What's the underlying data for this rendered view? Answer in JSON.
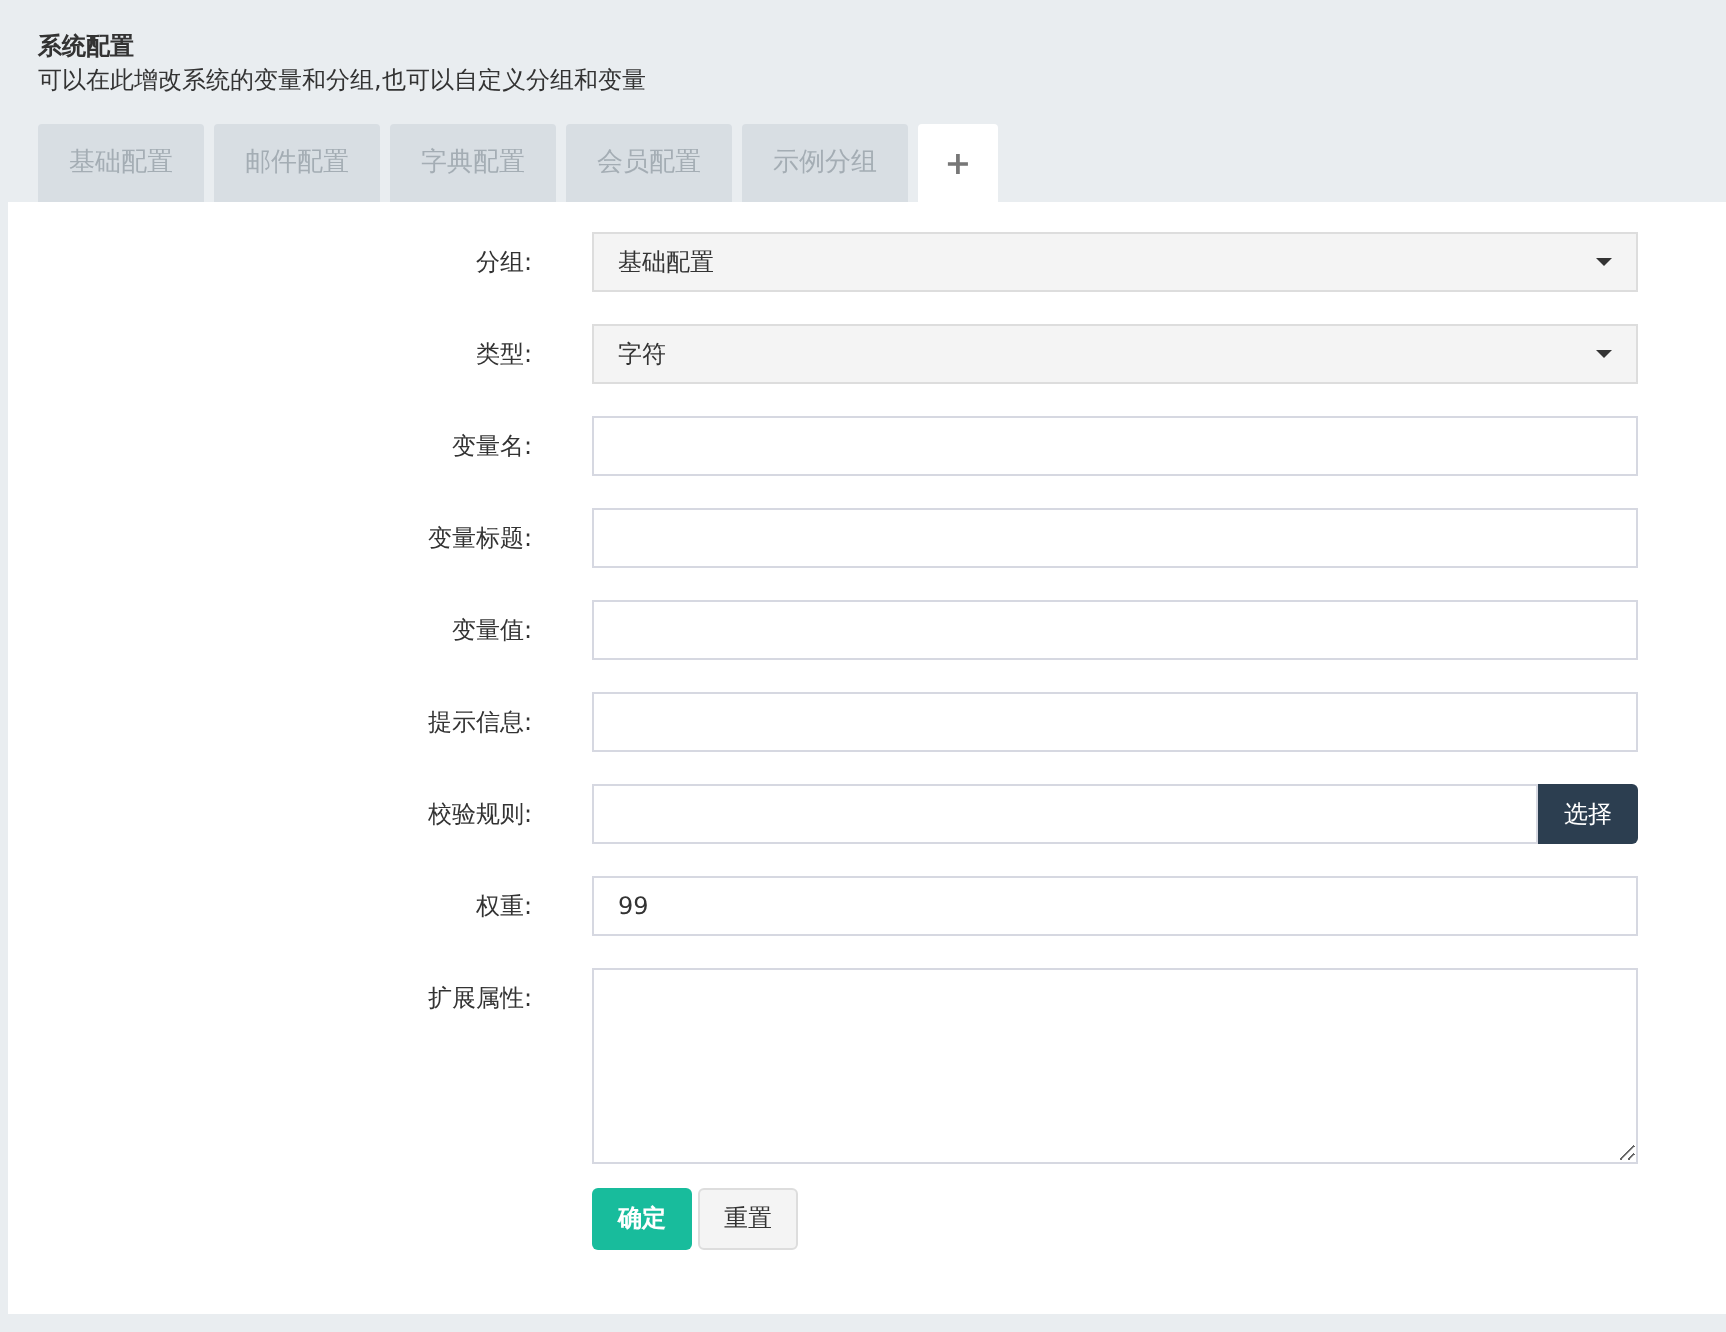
{
  "header": {
    "title": "系统配置",
    "description": "可以在此增改系统的变量和分组,也可以自定义分组和变量"
  },
  "tabs": [
    {
      "label": "基础配置",
      "selected": false
    },
    {
      "label": "邮件配置",
      "selected": false
    },
    {
      "label": "字典配置",
      "selected": false
    },
    {
      "label": "会员配置",
      "selected": false
    },
    {
      "label": "示例分组",
      "selected": false
    },
    {
      "label": "+",
      "selected": true
    }
  ],
  "form": {
    "fields": [
      {
        "kind": "select",
        "label": "分组:",
        "value": "基础配置"
      },
      {
        "kind": "select",
        "label": "类型:",
        "value": "字符"
      },
      {
        "kind": "text",
        "label": "变量名:"
      },
      {
        "kind": "text",
        "label": "变量标题:"
      },
      {
        "kind": "text",
        "label": "变量值:"
      },
      {
        "kind": "text",
        "label": "提示信息:"
      },
      {
        "kind": "button-input",
        "label": "校验规则:",
        "button": "选择"
      },
      {
        "kind": "text",
        "label": "权重:",
        "value": "99"
      },
      {
        "kind": "textarea",
        "label": "扩展属性:"
      }
    ],
    "buttons": [
      {
        "kind": "primary",
        "label": "确定"
      },
      {
        "kind": "default",
        "label": "重置"
      }
    ]
  }
}
